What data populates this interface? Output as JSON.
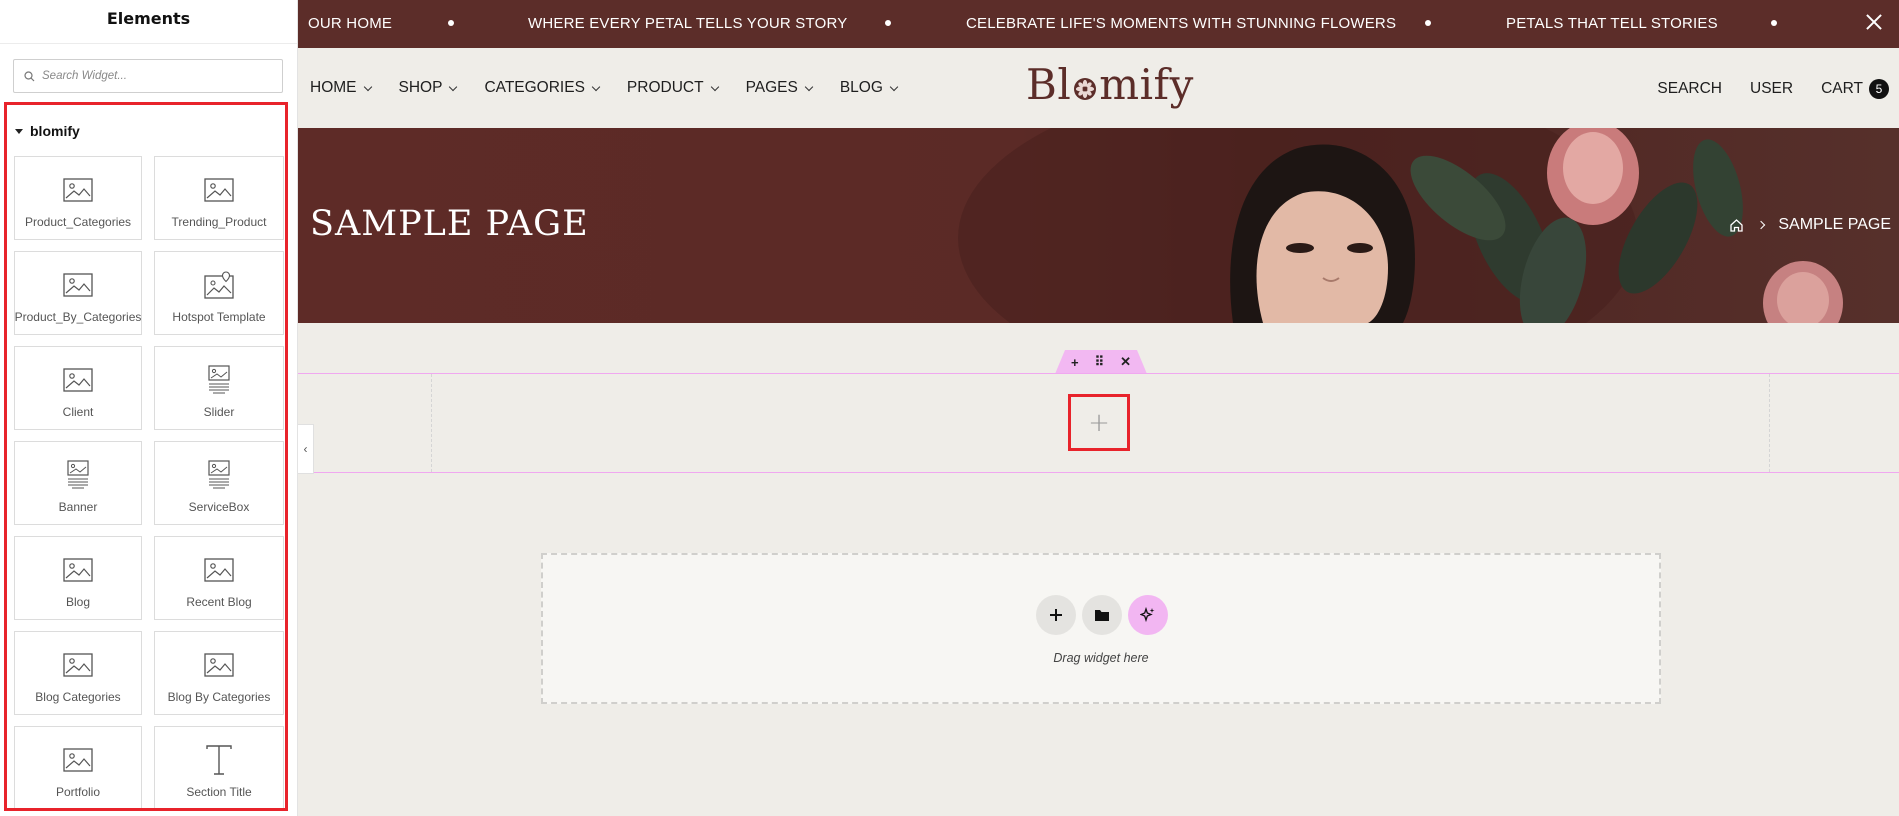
{
  "sidebar": {
    "title": "Elements",
    "search_placeholder": "Search Widget...",
    "category": "blomify",
    "collapse_glyph": "‹",
    "widgets": [
      {
        "label": "Product_Categories",
        "icon": "image-icon"
      },
      {
        "label": "Trending_Product",
        "icon": "image-icon"
      },
      {
        "label": "Product_By_Categories",
        "icon": "image-icon"
      },
      {
        "label": "Hotspot Template",
        "icon": "image-pin-icon"
      },
      {
        "label": "Client",
        "icon": "image-icon"
      },
      {
        "label": "Slider",
        "icon": "slider-icon"
      },
      {
        "label": "Banner",
        "icon": "slider-icon"
      },
      {
        "label": "ServiceBox",
        "icon": "slider-icon"
      },
      {
        "label": "Blog",
        "icon": "image-icon"
      },
      {
        "label": "Recent Blog",
        "icon": "image-icon"
      },
      {
        "label": "Blog Categories",
        "icon": "image-icon"
      },
      {
        "label": "Blog By Categories",
        "icon": "image-icon"
      },
      {
        "label": "Portfolio",
        "icon": "image-icon"
      },
      {
        "label": "Section Title",
        "icon": "title-icon"
      }
    ]
  },
  "marquee": {
    "items": [
      "OUR HOME",
      "WHERE EVERY PETAL TELLS YOUR STORY",
      "CELEBRATE LIFE'S MOMENTS WITH STUNNING FLOWERS",
      "PETALS THAT TELL STORIES"
    ]
  },
  "header": {
    "nav": [
      "HOME",
      "SHOP",
      "CATEGORIES",
      "PRODUCT",
      "PAGES",
      "BLOG"
    ],
    "logo": {
      "before": "Bl",
      "after": "mify"
    },
    "search": "SEARCH",
    "user": "USER",
    "cart": "CART",
    "cart_count": "5"
  },
  "hero": {
    "title": "SAMPLE PAGE",
    "breadcrumb_current": "SAMPLE PAGE"
  },
  "editor": {
    "handle_add": "+",
    "handle_move": "⠿",
    "handle_close": "✕",
    "add_glyph": "+",
    "drop_text": "Drag widget here"
  },
  "colors": {
    "brand": "#5c2d29",
    "highlight": "#e8232b",
    "editor_accent": "#f2b8f2",
    "page_bg": "#efede8"
  }
}
